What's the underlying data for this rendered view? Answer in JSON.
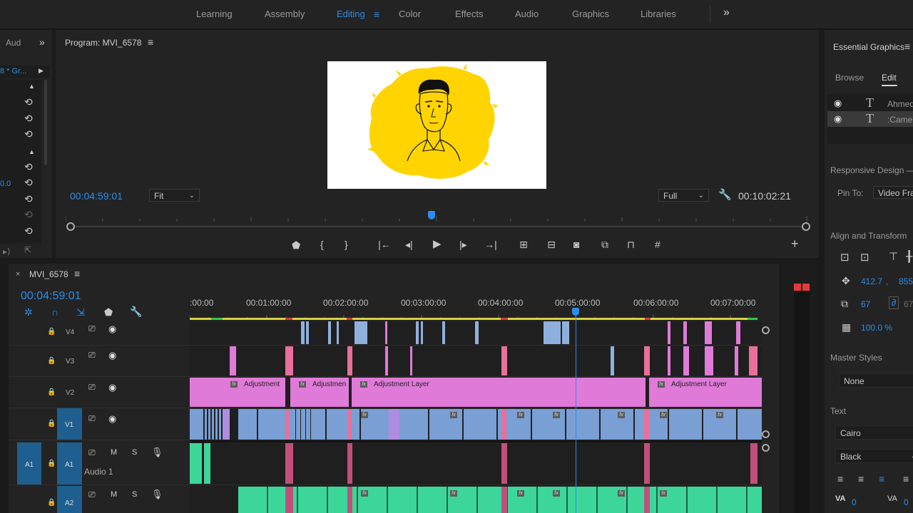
{
  "workspaces": {
    "tabs": [
      "Learning",
      "Assembly",
      "Editing",
      "Color",
      "Effects",
      "Audio",
      "Graphics",
      "Libraries"
    ],
    "active": "Editing",
    "more_label": "»"
  },
  "left_panel": {
    "tab_label": "Aud",
    "clip_label": "8 * Gr...",
    "value_label": "0.0"
  },
  "program_monitor": {
    "title": "Program: MVI_6578",
    "menu_icon": "hamburger-icon",
    "current_time": "00:04:59:01",
    "zoom": "Fit",
    "resolution": "Full",
    "duration": "00:10:02:21"
  },
  "timeline": {
    "sequence_name": "MVI_6578",
    "current_time": "00:04:59:01",
    "ruler_labels": [
      ":00:00",
      "00:01:00:00",
      "00:02:00:00",
      "00:03:00:00",
      "00:04:00:00",
      "00:05:00:00",
      "00:06:00:00",
      "00:07:00:00"
    ],
    "tracks": {
      "v4": "V4",
      "v3": "V3",
      "v2": "V2",
      "v1": "V1",
      "a1": "A1",
      "a1_source": "A1",
      "a1_name": "Audio 1",
      "a2": "A2",
      "mute": "M",
      "solo": "S"
    },
    "adjustment_labels": [
      "Adjustment",
      "Adjustmen",
      "Adjustment Layer",
      "Adjustment Layer"
    ],
    "fx_label": "fx"
  },
  "essential_graphics": {
    "title": "Essential Graphics",
    "tabs": [
      "Browse",
      "Edit"
    ],
    "active_tab": "Edit",
    "layers": [
      "Ahmed",
      ":Camer"
    ],
    "responsive_design": "Responsive Design —",
    "pin_to_label": "Pin To:",
    "pin_to_value": "Video Fra",
    "align_transform": "Align and Transform",
    "position_x": "412.7",
    "position_sep": ",",
    "position_y": "855",
    "scale": "67",
    "scale_2": "67",
    "opacity": "100.0 %",
    "master_styles": "Master Styles",
    "master_style_value": "None",
    "text_label": "Text",
    "font": "Cairo",
    "font_style": "Black",
    "kerning_label": "VA",
    "kerning_value": "0",
    "tracking_label": "VA",
    "tracking_value": "0"
  }
}
